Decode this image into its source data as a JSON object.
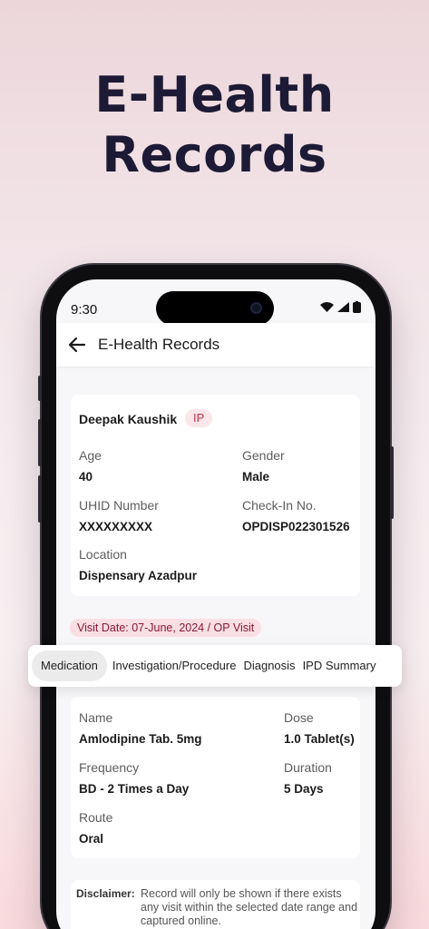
{
  "hero": {
    "line1": "E-Health",
    "line2": "Records"
  },
  "status_bar": {
    "time": "9:30"
  },
  "app_bar": {
    "title": "E-Health Records"
  },
  "patient": {
    "name": "Deepak Kaushik",
    "type_badge": "IP",
    "age_label": "Age",
    "age": "40",
    "gender_label": "Gender",
    "gender": "Male",
    "uhid_label": "UHID Number",
    "uhid": "XXXXXXXXX",
    "checkin_label": "Check-In No.",
    "checkin": "OPDISP022301526",
    "location_label": "Location",
    "location": "Dispensary Azadpur"
  },
  "visit": {
    "date_badge": "Visit Date: 07-June, 2024 / OP Visit"
  },
  "tabs": [
    {
      "label": "Medication",
      "active": true
    },
    {
      "label": "Investigation/Procedure",
      "active": false
    },
    {
      "label": "Diagnosis",
      "active": false
    },
    {
      "label": "IPD Summary",
      "active": false
    }
  ],
  "medication": {
    "name_label": "Name",
    "name": "Amlodipine Tab. 5mg",
    "dose_label": "Dose",
    "dose": "1.0 Tablet(s)",
    "frequency_label": "Frequency",
    "frequency": "BD - 2 Times a Day",
    "duration_label": "Duration",
    "duration": "5 Days",
    "route_label": "Route",
    "route": "Oral"
  },
  "disclaimer": {
    "label": "Disclaimer:",
    "text": "Record will only be shown if there exists any visit within the selected date range and captured online."
  },
  "colors": {
    "title_navy": "#1d1a35",
    "badge_red": "#c2344d",
    "visit_badge_text": "#8a1736",
    "visit_badge_bg": "#f9dfe3"
  }
}
